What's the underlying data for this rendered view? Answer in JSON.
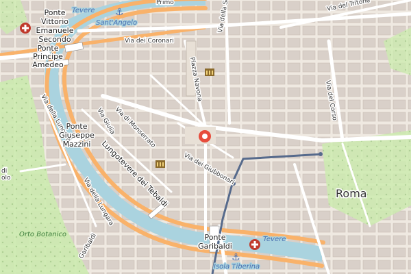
{
  "map": {
    "labels": {
      "tevere_top": "Tevere",
      "sant_angelo": "Sant'Angelo",
      "primo": "Primo",
      "via_dei_coronari": "Via dei Coronari",
      "via_del_tritone": "Via del Tritone",
      "ponte_vittorio": "Ponte\nVittorio\nEmanuele\nSecondo",
      "ponte_principe": "Ponte\nPrincipe\nAmedeo",
      "piazza_navona": "Piazza Navona",
      "via_del_corso": "Via del Corso",
      "via_della_lungara_top": "Via della Lungara",
      "ponte_mazzini": "Ponte\nGiuseppe\nMazzini",
      "via_giulia": "Via Giulia",
      "via_di_monserrato": "Via di Monserrato",
      "lungotevere_tebaldi": "Lungotevere dei Tebaldi",
      "via_dei_giubbonari": "Via dei Giubbonari",
      "via_della_lungara_bottom": "Via della Lungara",
      "roma": "Roma",
      "orto_botanico": "Orto Botanico",
      "garibaldi": "Garibaldi",
      "ponte_garibaldi": "Ponte\nGaribaldi",
      "tevere_bottom": "Tevere",
      "isola_tiberina": "Isola Tiberina",
      "olo": "olo",
      "di": "di",
      "via_della_sc": "Via della Sc"
    },
    "colors": {
      "background": "#efe9e1",
      "building": "#d9d0c9",
      "water": "#aad3df",
      "river_road": "#f9b26a",
      "park": "#cdebb0",
      "marker": "#e74c3c",
      "tram": "#566a8c"
    },
    "icons": {
      "marker": "map-pin-icon",
      "hospital": "hospital-icon",
      "museum": "museum-icon",
      "anchor": "anchor-icon"
    }
  }
}
